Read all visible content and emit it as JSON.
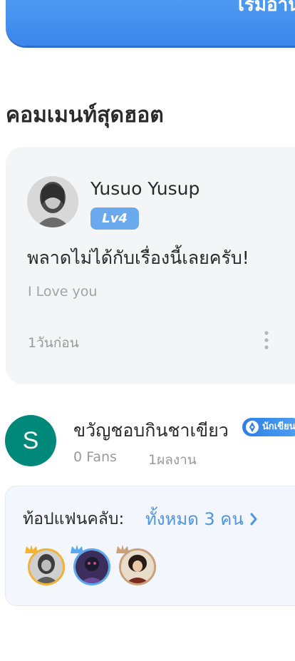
{
  "read_button": {
    "label": "เริ่มอ่าน"
  },
  "hot_comments": {
    "title": "คอมเมนท์สุดฮอต",
    "comment": {
      "author": "Yusuo Yusup",
      "level": "Lv4",
      "text": "พลาดไม่ได้กับเรื่องนี้เลยครับ!",
      "subtext": "I Love you",
      "time": "1วันก่อน"
    }
  },
  "author": {
    "avatar_letter": "S",
    "name": "ขวัญชอบกินชาเขียว",
    "badge": "นักเขียน",
    "fans": "0 Fans",
    "works": "1ผลงาน",
    "avatar_color": "#00897b"
  },
  "fan_club": {
    "label": "ท้อปแฟนคลับ:",
    "all_link": "ทั้งหมด 3 คน",
    "link_color": "#4f95e6",
    "members": [
      {
        "ring_color": "#f2b232"
      },
      {
        "ring_color": "#5aa9f0"
      },
      {
        "ring_color": "#c9a27a"
      }
    ]
  },
  "colors": {
    "accent": "#3a86ec",
    "level_badge": "#6aa9ee"
  }
}
